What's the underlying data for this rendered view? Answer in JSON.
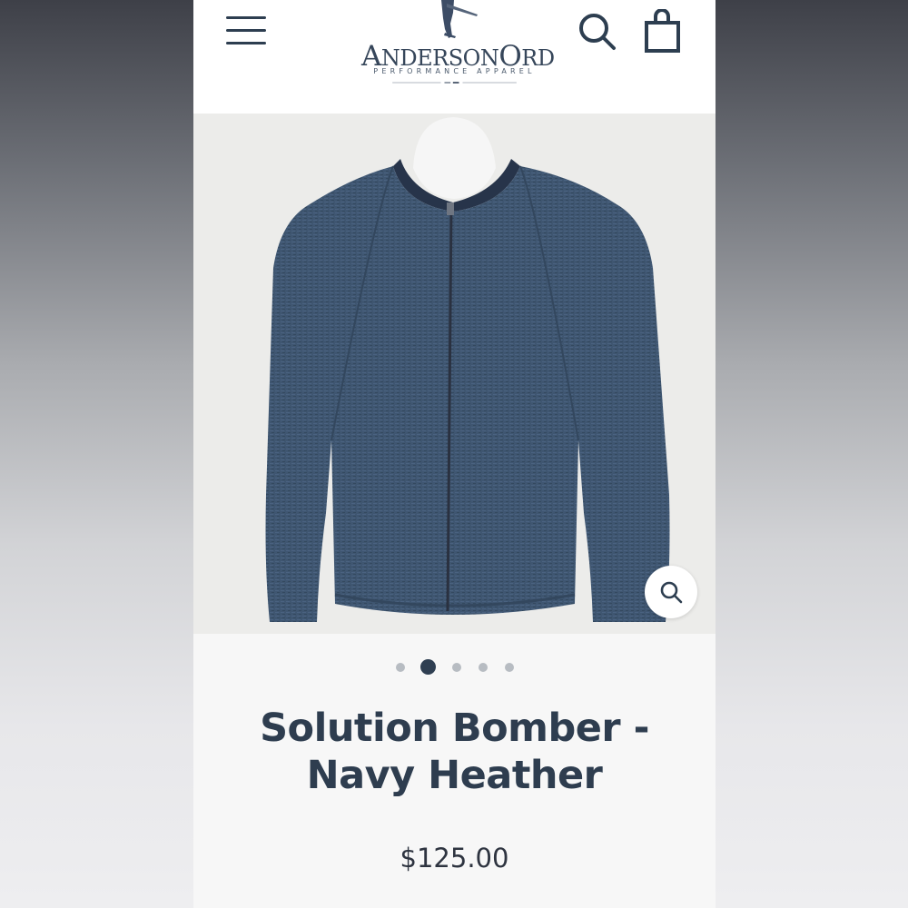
{
  "header": {
    "menu_icon": "hamburger-menu-icon",
    "logo": {
      "name_first_initial": "A",
      "name_first_rest": "NDERSON",
      "name_second_initial": "O",
      "name_second_rest": "RD",
      "tagline": "PERFORMANCE APPAREL"
    },
    "search_icon": "search-icon",
    "cart_icon": "shopping-bag-icon"
  },
  "product": {
    "image_icon": "zoom-icon",
    "title_line1": "Solution Bomber -",
    "title_line2": "Navy Heather",
    "price": "$125.00",
    "gallery": {
      "count": 5,
      "active_index": 1
    }
  },
  "colors": {
    "navy_text": "#2e3d4f",
    "jacket": "#3e5570"
  }
}
